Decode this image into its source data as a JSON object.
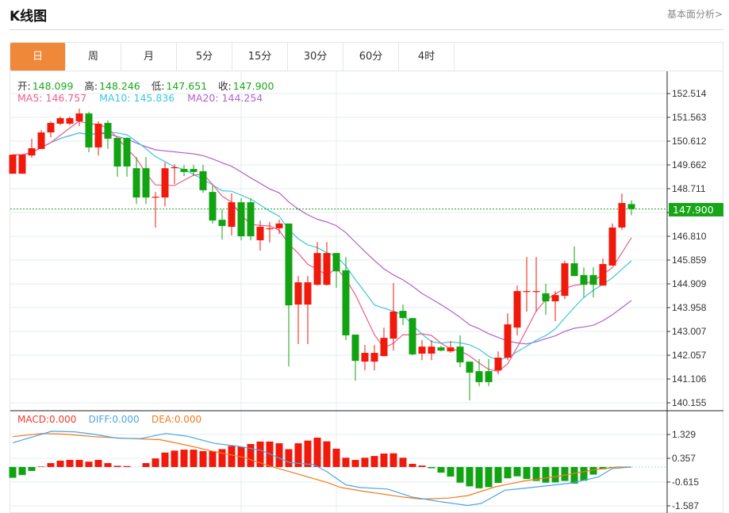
{
  "header": {
    "title": "K线图",
    "link": "基本面分析>"
  },
  "tabs": [
    {
      "label": "日",
      "active": true
    },
    {
      "label": "周"
    },
    {
      "label": "月"
    },
    {
      "label": "5分"
    },
    {
      "label": "15分"
    },
    {
      "label": "30分"
    },
    {
      "label": "60分"
    },
    {
      "label": "4时"
    }
  ],
  "info": {
    "open_label": "开:",
    "open": "148.099",
    "high_label": "高:",
    "high": "148.246",
    "low_label": "低:",
    "low": "147.651",
    "close_label": "收:",
    "close": "147.900"
  },
  "ma": {
    "ma5": "MA5: 146.757",
    "ma10": "MA10: 145.836",
    "ma20": "MA20: 144.254"
  },
  "macd_info": {
    "macd": "MACD:0.000",
    "diff": "DIFF:0.000",
    "dea": "DEA:0.000"
  },
  "colors": {
    "up": "#ef1a0c",
    "down": "#12a312",
    "ma5": "#ee5b8a",
    "ma10": "#3ec6e0",
    "ma20": "#b55fcb",
    "diff": "#4aa6e6",
    "dea": "#f27a1c",
    "last": "#16a616"
  },
  "chart_data": [
    {
      "type": "candlestick",
      "price_ticks": [
        "152.514",
        "151.563",
        "150.612",
        "149.662",
        "148.711",
        "147.759",
        "146.810",
        "145.859",
        "144.909",
        "143.958",
        "143.007",
        "142.057",
        "141.106",
        "140.155"
      ],
      "hidden_tick": "147.759",
      "ylim": [
        140.155,
        152.514
      ],
      "last_price": "147.900",
      "ohlc": [
        [
          149.31,
          150.07,
          149.31,
          150.07
        ],
        [
          149.31,
          150.07,
          149.31,
          150.07
        ],
        [
          150.04,
          150.71,
          149.95,
          150.33
        ],
        [
          150.3,
          151.06,
          150.3,
          150.96
        ],
        [
          150.96,
          151.41,
          150.77,
          151.34
        ],
        [
          151.31,
          151.6,
          151.25,
          151.53
        ],
        [
          151.31,
          151.6,
          151.25,
          151.53
        ],
        [
          151.41,
          151.91,
          151.21,
          151.72
        ],
        [
          151.72,
          151.79,
          150.17,
          150.36
        ],
        [
          150.36,
          151.41,
          150.04,
          151.31
        ],
        [
          151.34,
          151.44,
          150.3,
          150.71
        ],
        [
          150.74,
          150.74,
          149.19,
          149.6
        ],
        [
          150.74,
          150.77,
          149.19,
          149.6
        ],
        [
          149.53,
          149.98,
          148.1,
          148.36
        ],
        [
          149.53,
          149.98,
          148.1,
          148.36
        ],
        [
          148.36,
          148.58,
          147.16,
          148.39
        ],
        [
          148.36,
          149.76,
          148.01,
          149.53
        ],
        [
          149.53,
          149.69,
          148.9,
          149.57
        ],
        [
          149.5,
          149.66,
          149.22,
          149.38
        ],
        [
          149.5,
          149.66,
          149.22,
          149.38
        ],
        [
          149.41,
          149.66,
          148.55,
          148.65
        ],
        [
          148.58,
          148.84,
          147.32,
          147.44
        ],
        [
          147.47,
          147.89,
          146.68,
          147.22
        ],
        [
          147.19,
          148.52,
          146.84,
          148.17
        ],
        [
          148.17,
          148.33,
          146.65,
          146.81
        ],
        [
          148.17,
          148.33,
          146.65,
          146.81
        ],
        [
          146.65,
          147.44,
          146.24,
          147.19
        ],
        [
          147.09,
          147.38,
          146.56,
          147.13
        ],
        [
          147.13,
          147.47,
          146.9,
          147.32
        ],
        [
          147.32,
          147.32,
          141.61,
          144.05
        ],
        [
          144.08,
          145.22,
          142.5,
          144.97
        ],
        [
          144.08,
          145.22,
          142.5,
          144.97
        ],
        [
          144.87,
          146.58,
          144.84,
          146.14
        ],
        [
          144.87,
          146.58,
          144.84,
          146.14
        ],
        [
          146.14,
          146.14,
          144.75,
          145.41
        ],
        [
          145.45,
          145.98,
          142.66,
          142.85
        ],
        [
          142.88,
          142.88,
          141.04,
          141.83
        ],
        [
          141.8,
          142.47,
          141.45,
          142.15
        ],
        [
          141.8,
          142.47,
          141.45,
          142.15
        ],
        [
          142.02,
          143.16,
          142.02,
          142.75
        ],
        [
          142.72,
          144.94,
          142.24,
          143.8
        ],
        [
          143.83,
          144.08,
          143.26,
          143.54
        ],
        [
          143.54,
          143.54,
          142.05,
          142.09
        ],
        [
          142.12,
          142.66,
          141.86,
          142.4
        ],
        [
          142.12,
          142.66,
          141.86,
          142.4
        ],
        [
          142.37,
          142.43,
          142.21,
          142.24
        ],
        [
          142.21,
          142.62,
          142.15,
          142.37
        ],
        [
          142.4,
          142.85,
          141.58,
          141.77
        ],
        [
          141.8,
          141.8,
          140.25,
          141.36
        ],
        [
          141.42,
          141.9,
          140.82,
          140.98
        ],
        [
          141.42,
          141.9,
          140.82,
          140.98
        ],
        [
          141.45,
          142.21,
          141.29,
          141.96
        ],
        [
          141.96,
          143.73,
          141.86,
          143.29
        ],
        [
          143.16,
          144.84,
          142.85,
          144.62
        ],
        [
          144.59,
          145.98,
          143.8,
          144.62
        ],
        [
          144.59,
          145.98,
          143.8,
          144.62
        ],
        [
          144.53,
          144.91,
          143.67,
          144.21
        ],
        [
          144.21,
          144.62,
          143.42,
          144.46
        ],
        [
          144.43,
          145.83,
          144.3,
          145.73
        ],
        [
          145.73,
          146.4,
          145.22,
          145.22
        ],
        [
          145.26,
          145.57,
          144.37,
          144.87
        ],
        [
          145.26,
          145.57,
          144.37,
          144.87
        ],
        [
          144.84,
          145.92,
          144.84,
          145.7
        ],
        [
          145.64,
          147.32,
          145.64,
          147.16
        ],
        [
          147.16,
          148.52,
          147.06,
          148.14
        ],
        [
          148.099,
          148.246,
          147.651,
          147.9
        ]
      ],
      "ma_periods": [
        5,
        10,
        20
      ]
    },
    {
      "type": "macd",
      "ticks": [
        "1.329",
        "0.357",
        "-0.615",
        "-1.587"
      ],
      "ylim": [
        -1.6,
        1.6
      ],
      "histogram": [
        -0.44,
        -0.33,
        -0.16,
        0.02,
        0.16,
        0.26,
        0.29,
        0.29,
        0.22,
        0.29,
        0.16,
        0.05,
        0.04,
        0.0,
        0.16,
        0.35,
        0.59,
        0.67,
        0.71,
        0.71,
        0.65,
        0.65,
        0.73,
        0.86,
        0.83,
        0.94,
        1.04,
        1.04,
        0.97,
        0.73,
        0.97,
        1.08,
        1.2,
        1.05,
        0.75,
        0.38,
        0.29,
        0.38,
        0.45,
        0.55,
        0.56,
        0.38,
        0.13,
        0.06,
        -0.05,
        -0.23,
        -0.39,
        -0.64,
        -0.79,
        -0.87,
        -0.82,
        -0.65,
        -0.46,
        -0.38,
        -0.49,
        -0.57,
        -0.64,
        -0.63,
        -0.57,
        -0.68,
        -0.56,
        -0.31,
        -0.09,
        -0.03,
        0.0,
        0.0
      ],
      "diff": [
        [
          0,
          0.99
        ],
        [
          4.1,
          1.46
        ],
        [
          6.5,
          1.44
        ],
        [
          8.5,
          1.34
        ],
        [
          11,
          1.18
        ],
        [
          13.4,
          1.16
        ],
        [
          16.1,
          1.37
        ],
        [
          18.3,
          1.26
        ],
        [
          21.3,
          0.96
        ],
        [
          23.7,
          0.85
        ],
        [
          26.2,
          0.67
        ],
        [
          29.1,
          0.18
        ],
        [
          31.6,
          0.1
        ],
        [
          33,
          -0.19
        ],
        [
          35,
          -0.73
        ],
        [
          36.5,
          -0.84
        ],
        [
          39.4,
          -0.9
        ],
        [
          41.9,
          -1.22
        ],
        [
          44.8,
          -1.41
        ],
        [
          47.8,
          -1.57
        ],
        [
          49.2,
          -1.49
        ],
        [
          51.7,
          -0.95
        ],
        [
          53.7,
          -0.87
        ],
        [
          55.6,
          -0.79
        ],
        [
          58.6,
          -0.66
        ],
        [
          61.5,
          -0.41
        ],
        [
          63,
          -0.06
        ],
        [
          65,
          0
        ]
      ],
      "dea": [
        [
          0,
          1.24
        ],
        [
          3.1,
          1.37
        ],
        [
          5.5,
          1.34
        ],
        [
          8.5,
          1.24
        ],
        [
          12.4,
          1.16
        ],
        [
          15.4,
          1.12
        ],
        [
          18.3,
          0.89
        ],
        [
          21.3,
          0.62
        ],
        [
          24.2,
          0.4
        ],
        [
          27.2,
          0.02
        ],
        [
          30.1,
          -0.3
        ],
        [
          33,
          -0.63
        ],
        [
          34.5,
          -0.84
        ],
        [
          37,
          -1.0
        ],
        [
          40.9,
          -1.22
        ],
        [
          42.9,
          -1.31
        ],
        [
          45.8,
          -1.27
        ],
        [
          47.8,
          -1.17
        ],
        [
          50.7,
          -0.81
        ],
        [
          53.7,
          -0.57
        ],
        [
          57.6,
          -0.36
        ],
        [
          61,
          -0.12
        ],
        [
          63.5,
          0
        ],
        [
          65,
          0
        ]
      ]
    }
  ]
}
